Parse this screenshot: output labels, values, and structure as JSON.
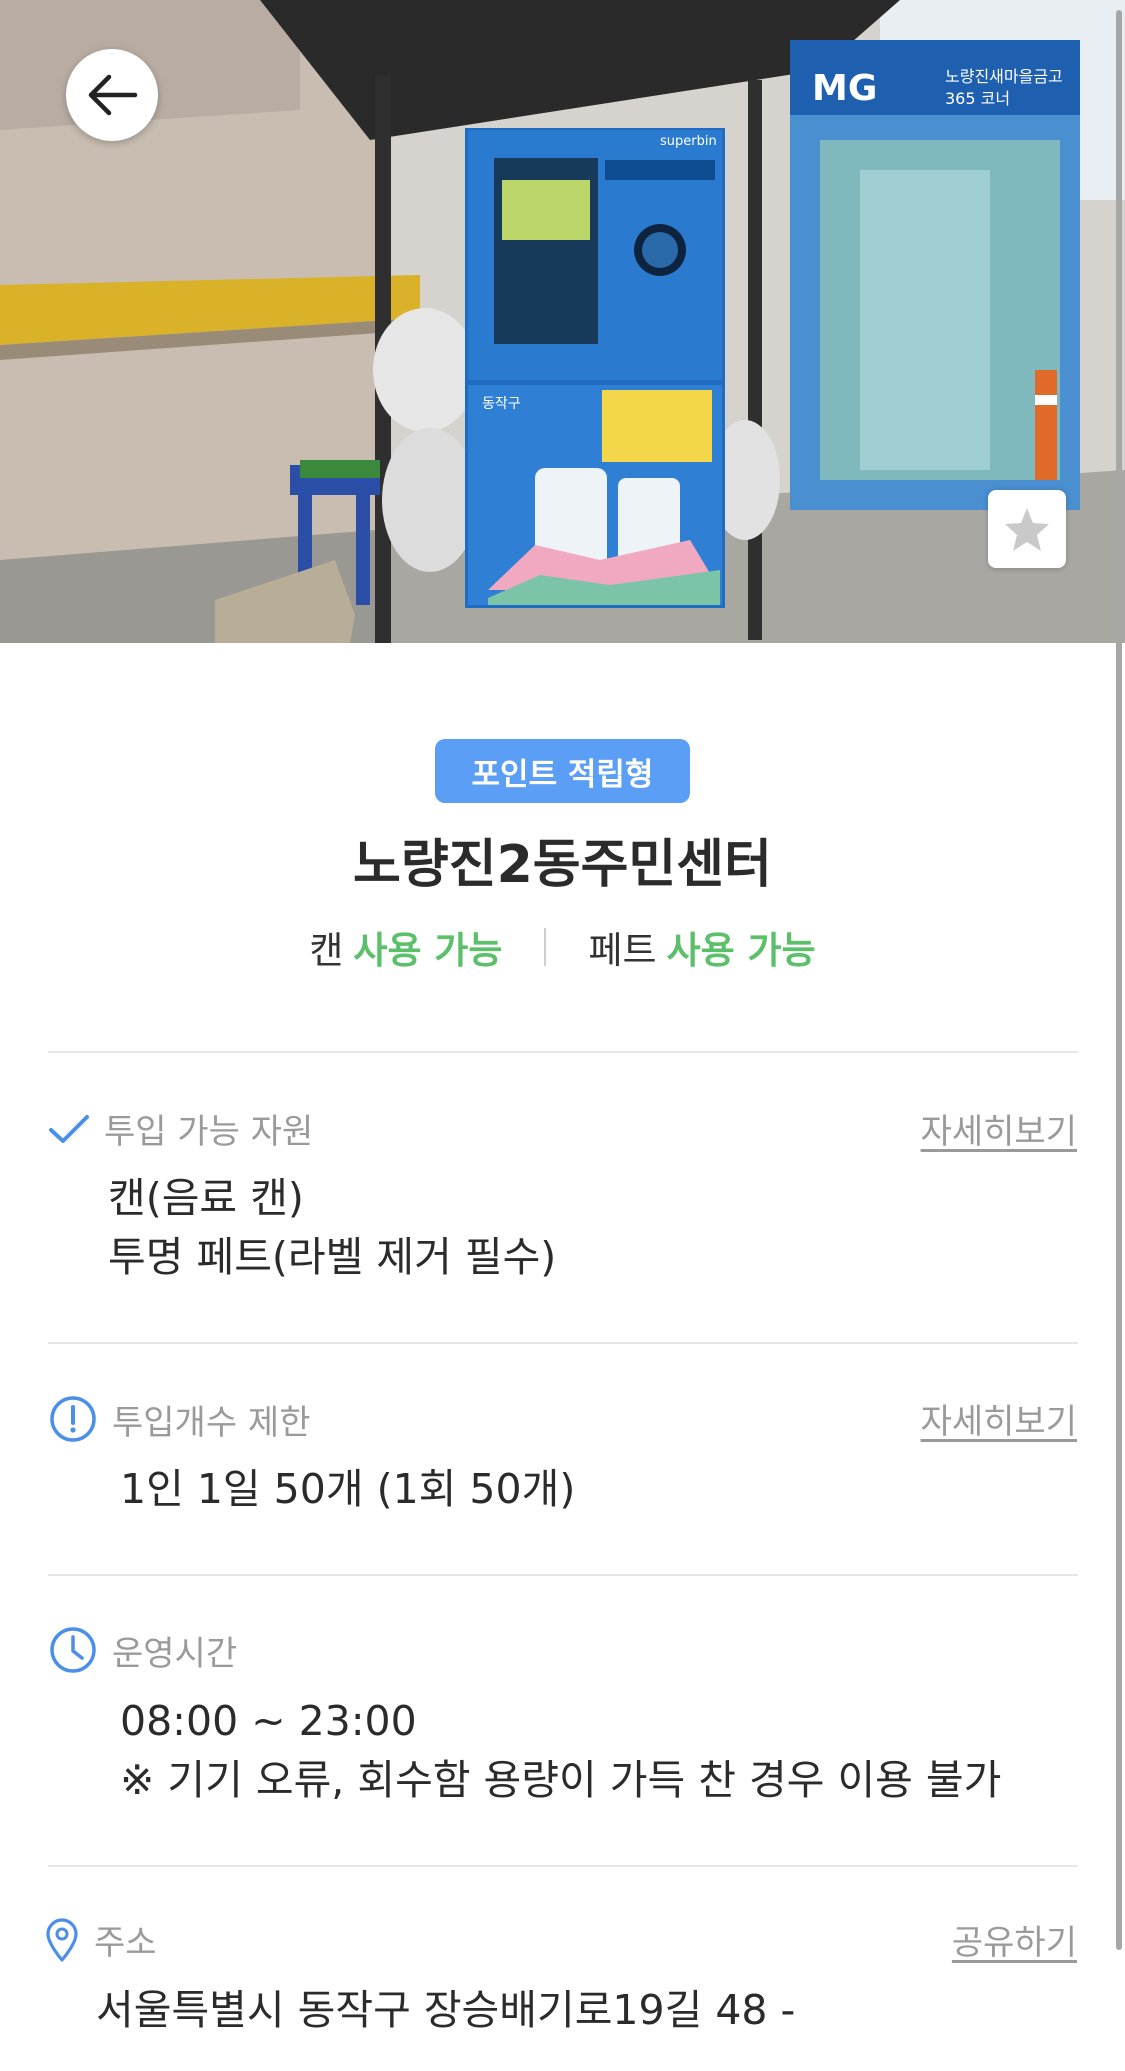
{
  "photo": {
    "description_icons": {
      "back": "arrow-left-icon",
      "favorite": "star-icon"
    },
    "sign_mg": "MG",
    "sign_bank": "노량진새마을금고",
    "sign_corner": "365 코너",
    "brand": "superbin",
    "kiosk_district": "동작구"
  },
  "badge": {
    "label": "포인트 적립형",
    "color": "#5b9ef5"
  },
  "place": {
    "name": "노량진2동주민센터"
  },
  "availability": {
    "can_label": "캔",
    "can_status": "사용 가능",
    "pet_label": "페트",
    "pet_status": "사용 가능",
    "status_color": "#5cbf6a"
  },
  "sections": {
    "materials": {
      "title": "투입 가능 자원",
      "link": "자세히보기",
      "icon": "checkmark-icon",
      "lines": [
        "캔(음료 캔)",
        "투명 페트(라벨 제거 필수)"
      ]
    },
    "limit": {
      "title": "투입개수 제한",
      "link": "자세히보기",
      "icon": "exclamation-circle-icon",
      "lines": [
        "1인 1일 50개 (1회 50개)"
      ]
    },
    "hours": {
      "title": "운영시간",
      "icon": "clock-icon",
      "lines": [
        "08:00 ~ 23:00",
        "※ 기기 오류, 회수함 용량이 가득 찬 경우 이용 불가"
      ]
    },
    "address": {
      "title": "주소",
      "link": "공유하기",
      "icon": "location-pin-icon",
      "lines": [
        "서울특별시 동작구 장승배기로19길 48 -"
      ]
    }
  }
}
